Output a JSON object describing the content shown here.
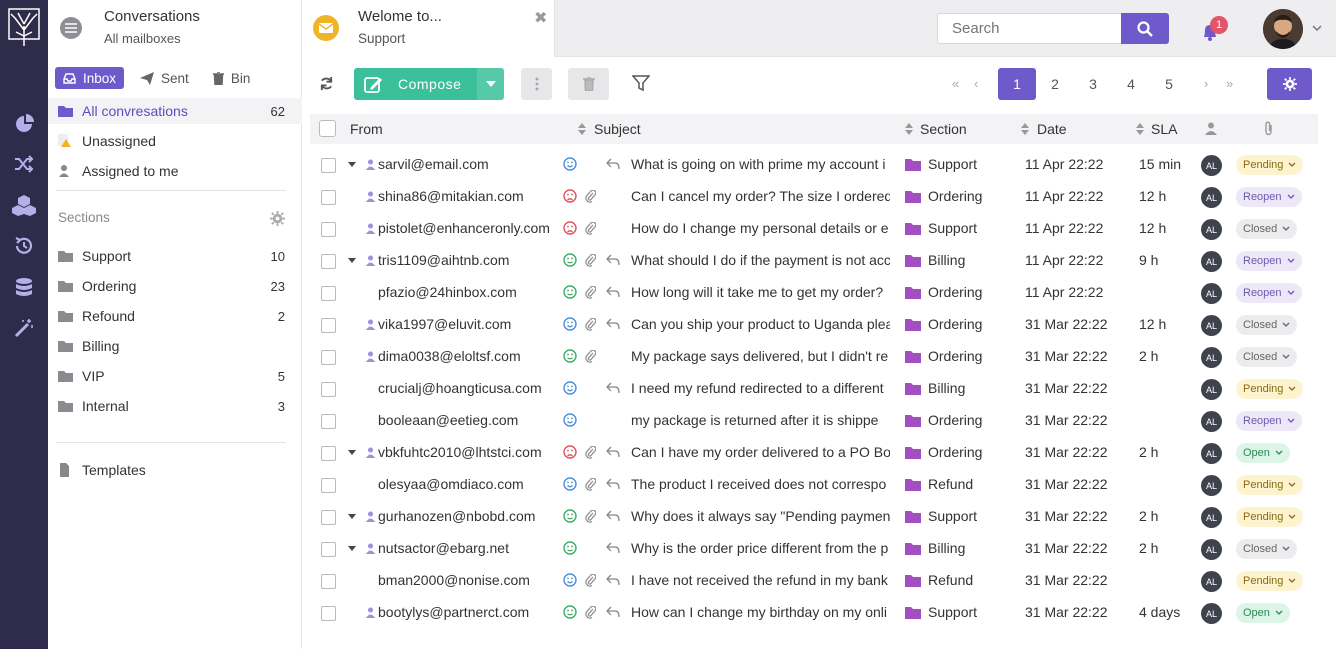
{
  "sidebar": {
    "mailbox_title": "Conversations",
    "mailbox_sub": "All mailboxes",
    "tabs": [
      "Inbox",
      "Sent",
      "Bin"
    ],
    "nav": [
      {
        "label": "All convresations",
        "count": "62"
      },
      {
        "label": "Unassigned",
        "count": ""
      },
      {
        "label": "Assigned to me",
        "count": ""
      }
    ],
    "sections_heading": "Sections",
    "sections": [
      {
        "label": "Support",
        "count": "10"
      },
      {
        "label": "Ordering",
        "count": "23"
      },
      {
        "label": "Refound",
        "count": "2"
      },
      {
        "label": "Billing",
        "count": ""
      },
      {
        "label": "VIP",
        "count": "5"
      },
      {
        "label": "Internal",
        "count": "3"
      }
    ],
    "templates": "Templates"
  },
  "topbar": {
    "tab_title": "Welome to...",
    "tab_sub": "Support",
    "search_placeholder": "Search",
    "notif_count": "1"
  },
  "toolbar": {
    "compose": "Compose",
    "pages": [
      "1",
      "2",
      "3",
      "4",
      "5"
    ]
  },
  "table": {
    "headers": {
      "from": "From",
      "subject": "Subject",
      "section": "Section",
      "date": "Date",
      "sla": "SLA"
    },
    "rows": [
      {
        "from": "sarvil@email.com",
        "subject": "What is going on with prime my account i",
        "section": "Support",
        "date": "11 Apr 22:22",
        "sla": "15 min",
        "agent": "AL",
        "status": "Pending",
        "mood": "happy",
        "thread": true,
        "person": true,
        "clip": false,
        "reply": true
      },
      {
        "from": "shina86@mitakian.com",
        "subject": "Can I cancel my order? The size I ordered",
        "section": "Ordering",
        "date": "11 Apr 22:22",
        "sla": "12 h",
        "agent": "AL",
        "status": "Reopen",
        "mood": "sad",
        "thread": false,
        "person": true,
        "clip": true,
        "reply": false
      },
      {
        "from": "pistolet@enhanceronly.com",
        "subject": "How do I change my personal details or e",
        "section": "Support",
        "date": "11 Apr 22:22",
        "sla": "12 h",
        "agent": "AL",
        "status": "Closed",
        "mood": "sad",
        "thread": false,
        "person": true,
        "clip": true,
        "reply": false
      },
      {
        "from": "tris1109@aihtnb.com",
        "subject": "What should I do if the payment is not acc",
        "section": "Billing",
        "date": "11 Apr 22:22",
        "sla": "9 h",
        "agent": "AL",
        "status": "Reopen",
        "mood": "ok",
        "thread": true,
        "person": true,
        "clip": true,
        "reply": true
      },
      {
        "from": "pfazio@24hinbox.com",
        "subject": "How long will it take me to get my order?",
        "section": "Ordering",
        "date": "11 Apr 22:22",
        "sla": "",
        "agent": "AL",
        "status": "Reopen",
        "mood": "ok",
        "thread": false,
        "person": false,
        "clip": true,
        "reply": true
      },
      {
        "from": "vika1997@eluvit.com",
        "subject": "Can you ship your product to Uganda plea",
        "section": "Ordering",
        "date": "31 Mar 22:22",
        "sla": "12 h",
        "agent": "AL",
        "status": "Closed",
        "mood": "happy",
        "thread": false,
        "person": true,
        "clip": true,
        "reply": true
      },
      {
        "from": "dima0038@eloltsf.com",
        "subject": "My package says delivered, but I didn't re",
        "section": "Ordering",
        "date": "31 Mar 22:22",
        "sla": "2 h",
        "agent": "AL",
        "status": "Closed",
        "mood": "ok",
        "thread": false,
        "person": true,
        "clip": true,
        "reply": false
      },
      {
        "from": "crucialj@hoangticusa.com",
        "subject": "I need my refund redirected to a different",
        "section": "Billing",
        "date": "31 Mar 22:22",
        "sla": "",
        "agent": "AL",
        "status": "Pending",
        "mood": "happy",
        "thread": false,
        "person": false,
        "clip": false,
        "reply": true
      },
      {
        "from": "booleaan@eetieg.com",
        "subject": " my package is returned after it is shippe",
        "section": "Ordering",
        "date": "31 Mar 22:22",
        "sla": "",
        "agent": "AL",
        "status": "Reopen",
        "mood": "happy",
        "thread": false,
        "person": false,
        "clip": false,
        "reply": false
      },
      {
        "from": "vbkfuhtc2010@lhtstci.com",
        "subject": "Can I have my order delivered to a PO Box",
        "section": "Ordering",
        "date": "31 Mar 22:22",
        "sla": "2 h",
        "agent": "AL",
        "status": "Open",
        "mood": "sad",
        "thread": true,
        "person": true,
        "clip": true,
        "reply": true
      },
      {
        "from": "olesyaa@omdiaco.com",
        "subject": "The product I received does not correspo",
        "section": "Refund",
        "date": "31 Mar 22:22",
        "sla": "",
        "agent": "AL",
        "status": "Pending",
        "mood": "happy",
        "thread": false,
        "person": false,
        "clip": true,
        "reply": true
      },
      {
        "from": "gurhanozen@nbobd.com",
        "subject": "Why does it always say \"Pending paymen",
        "section": "Support",
        "date": "31 Mar 22:22",
        "sla": "2 h",
        "agent": "AL",
        "status": "Pending",
        "mood": "ok",
        "thread": true,
        "person": true,
        "clip": true,
        "reply": true
      },
      {
        "from": "nutsactor@ebarg.net",
        "subject": "Why is the order price different from the p",
        "section": "Billing",
        "date": "31 Mar 22:22",
        "sla": "2 h",
        "agent": "AL",
        "status": "Closed",
        "mood": "ok",
        "thread": true,
        "person": true,
        "clip": false,
        "reply": true
      },
      {
        "from": "bman2000@nonise.com",
        "subject": "I have not received the refund in my bank",
        "section": "Refund",
        "date": "31 Mar 22:22",
        "sla": "",
        "agent": "AL",
        "status": "Pending",
        "mood": "happy",
        "thread": false,
        "person": false,
        "clip": true,
        "reply": true
      },
      {
        "from": "bootylys@partnerct.com",
        "subject": "How can I change my birthday on my onli",
        "section": "Support",
        "date": "31 Mar 22:22",
        "sla": "4 days",
        "agent": "AL",
        "status": "Open",
        "mood": "ok",
        "thread": false,
        "person": true,
        "clip": true,
        "reply": true
      }
    ]
  },
  "colors": {
    "accent": "#6f5acb",
    "rail": "#2f2b4a",
    "compose": "#3cbf9b",
    "happy": "#4a90d9",
    "sad": "#e0525f",
    "ok": "#3cae6a"
  }
}
